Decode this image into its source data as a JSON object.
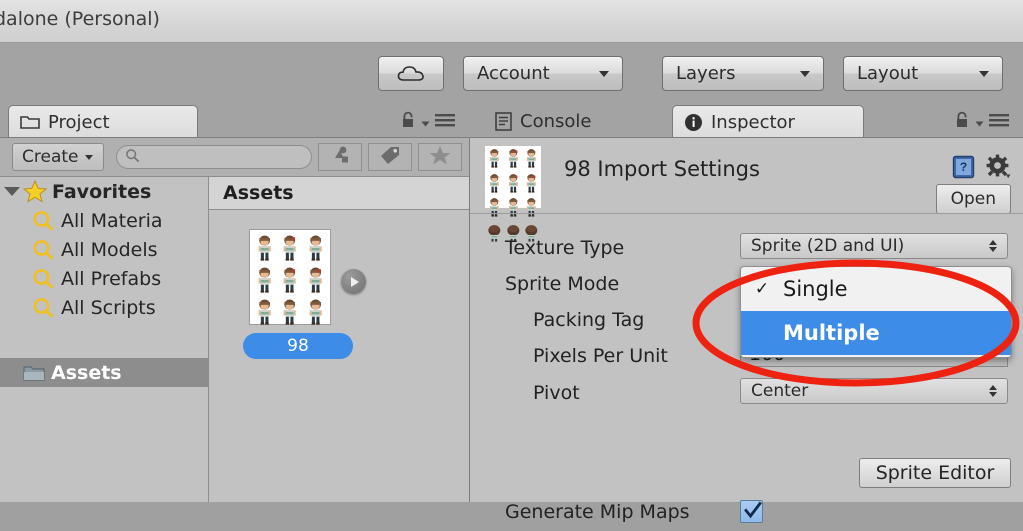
{
  "window": {
    "title": "dalone (Personal)"
  },
  "toolbar": {
    "cloud_button": {
      "name": "cloud-icon",
      "label": ""
    },
    "account_button": {
      "label": "Account"
    },
    "layers_button": {
      "label": "Layers"
    },
    "layout_button": {
      "label": "Layout"
    }
  },
  "project_panel": {
    "tab_label": "Project",
    "tab_icon": "folder-icon",
    "lock_icon": "lock-icon",
    "menu_icon": "hamburger-menu-icon",
    "create_button": "Create",
    "search": {
      "value": "",
      "placeholder": ""
    },
    "filters": [
      {
        "name": "type-filter-icon"
      },
      {
        "name": "label-filter-icon"
      },
      {
        "name": "favorites-star-icon"
      }
    ],
    "tree": [
      {
        "label": "Favorites",
        "level": 0,
        "expanded": true,
        "icon": "star-icon",
        "selected": false
      },
      {
        "label": "All Materia",
        "level": 1,
        "icon": "search-icon",
        "selected": false
      },
      {
        "label": "All Models",
        "level": 1,
        "icon": "search-icon",
        "selected": false
      },
      {
        "label": "All Prefabs",
        "level": 1,
        "icon": "search-icon",
        "selected": false
      },
      {
        "label": "All Scripts",
        "level": 1,
        "icon": "search-icon",
        "selected": false
      },
      {
        "label": "Assets",
        "level": 0,
        "icon": "folder-icon",
        "selected": true
      }
    ],
    "grid_header": "Assets",
    "asset": {
      "label": "98",
      "selected": true,
      "expand_icon": "expand-arrow-icon"
    }
  },
  "inspector_panel": {
    "tabs": [
      {
        "label": "Console",
        "icon": "console-icon",
        "active": false
      },
      {
        "label": "Inspector",
        "icon": "info-icon",
        "active": true
      }
    ],
    "lock_icon": "lock-icon",
    "menu_icon": "hamburger-menu-icon",
    "title": "98 Import Settings",
    "help_icon": "help-book-icon",
    "gear_icon": "gear-icon",
    "open_button": "Open",
    "properties": [
      {
        "label": "Texture Type",
        "level": 0,
        "control": "dropdown",
        "value": "Sprite (2D and UI)"
      },
      {
        "label": "Sprite Mode",
        "level": 0,
        "control": "dropdown-open",
        "value": "Multiple"
      },
      {
        "label": "Packing Tag",
        "level": 1,
        "control": "hidden",
        "value": ""
      },
      {
        "label": "Pixels Per Unit",
        "level": 1,
        "control": "input",
        "value": "100"
      },
      {
        "label": "Pivot",
        "level": 1,
        "control": "dropdown",
        "value": "Center"
      }
    ],
    "sprite_editor_button": "Sprite Editor",
    "mip_maps": {
      "label": "Generate Mip Maps",
      "checked": true
    }
  },
  "sprite_mode_dropdown": {
    "open": true,
    "options": [
      {
        "label": "Single",
        "checked": true,
        "highlighted": false
      },
      {
        "label": "Multiple",
        "checked": false,
        "highlighted": true
      }
    ]
  },
  "annotation": {
    "shape": "ellipse",
    "color": "#ee2211",
    "target": "sprite-mode-dropdown"
  },
  "colors": {
    "highlight_blue": "#3d8ce8",
    "panel_gray": "#c2c2c2",
    "toolbar_gray": "#a3a3a3",
    "titlebar_gray": "#d8d8d8",
    "annotation_red": "#ee2211"
  }
}
